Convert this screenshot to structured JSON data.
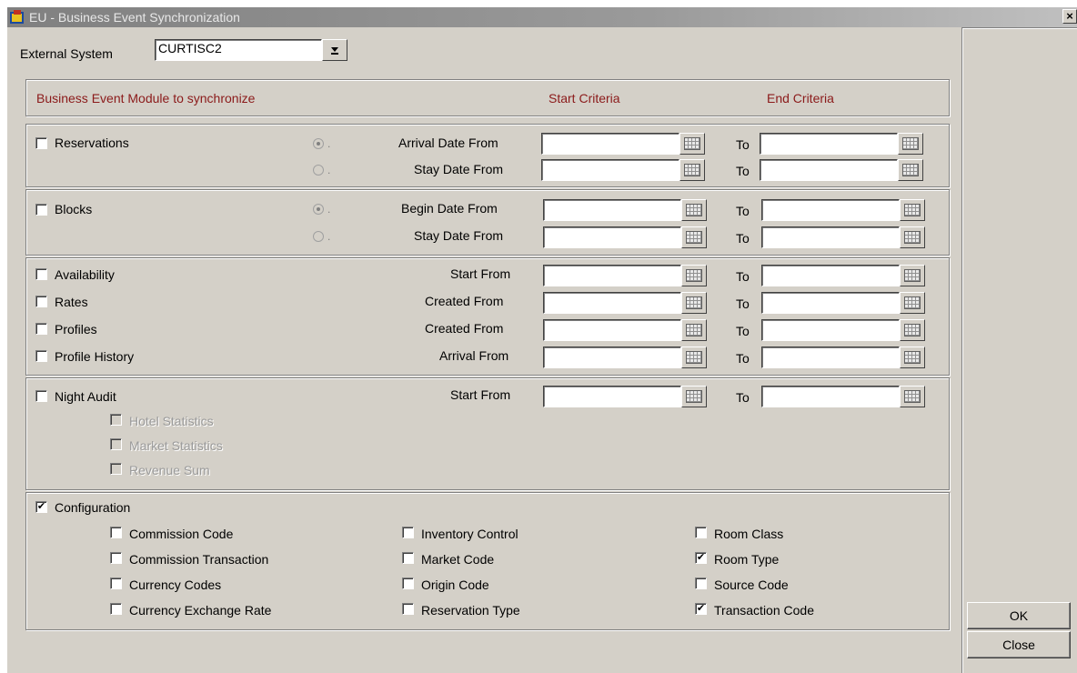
{
  "window": {
    "title": "EU - Business Event Synchronization",
    "close_glyph": "×"
  },
  "external_system": {
    "label": "External System",
    "value": "CURTISC2",
    "dropdown_glyph": "⬇"
  },
  "header": {
    "module_label": "Business Event Module to synchronize",
    "start_label": "Start Criteria",
    "end_label": "End Criteria"
  },
  "reservations": {
    "label": "Reservations",
    "checked": false,
    "rows": [
      {
        "criteria": "Arrival Date From",
        "selected": true,
        "start": "",
        "end_label": "To",
        "end": ""
      },
      {
        "criteria": "Stay Date From",
        "selected": false,
        "start": "",
        "end_label": "To",
        "end": ""
      }
    ]
  },
  "blocks": {
    "label": "Blocks",
    "checked": false,
    "rows": [
      {
        "criteria": "Begin Date From",
        "selected": true,
        "start": "",
        "end_label": "To",
        "end": ""
      },
      {
        "criteria": "Stay Date From",
        "selected": false,
        "start": "",
        "end_label": "To",
        "end": ""
      }
    ]
  },
  "modules": [
    {
      "label": "Availability",
      "checked": false,
      "criteria": "Start From",
      "end_label": "To"
    },
    {
      "label": "Rates",
      "checked": false,
      "criteria": "Created From",
      "end_label": "To"
    },
    {
      "label": "Profiles",
      "checked": false,
      "criteria": "Created From",
      "end_label": "To"
    },
    {
      "label": "Profile History",
      "checked": false,
      "criteria": "Arrival From",
      "end_label": "To"
    }
  ],
  "night_audit": {
    "label": "Night Audit",
    "checked": false,
    "criteria": "Start From",
    "end_label": "To",
    "sub": [
      {
        "label": "Hotel Statistics",
        "checked": false
      },
      {
        "label": "Market Statistics",
        "checked": false
      },
      {
        "label": "Revenue Sum",
        "checked": false
      }
    ]
  },
  "configuration": {
    "label": "Configuration",
    "checked": true,
    "col1": [
      {
        "label": "Commission Code",
        "checked": false
      },
      {
        "label": "Commission Transaction",
        "checked": false
      },
      {
        "label": "Currency Codes",
        "checked": false
      },
      {
        "label": "Currency Exchange Rate",
        "checked": false
      }
    ],
    "col2": [
      {
        "label": "Inventory Control",
        "checked": false
      },
      {
        "label": "Market Code",
        "checked": false
      },
      {
        "label": "Origin Code",
        "checked": false
      },
      {
        "label": "Reservation Type",
        "checked": false
      }
    ],
    "col3": [
      {
        "label": "Room Class",
        "checked": false
      },
      {
        "label": "Room Type",
        "checked": true
      },
      {
        "label": "Source Code",
        "checked": false
      },
      {
        "label": "Transaction Code",
        "checked": true
      }
    ]
  },
  "buttons": {
    "ok": "OK",
    "close": "Close"
  },
  "icons": {
    "app": "app-icon",
    "calendar": "calendar-icon",
    "dropdown": "dropdown-arrow-icon",
    "close": "close-icon"
  }
}
